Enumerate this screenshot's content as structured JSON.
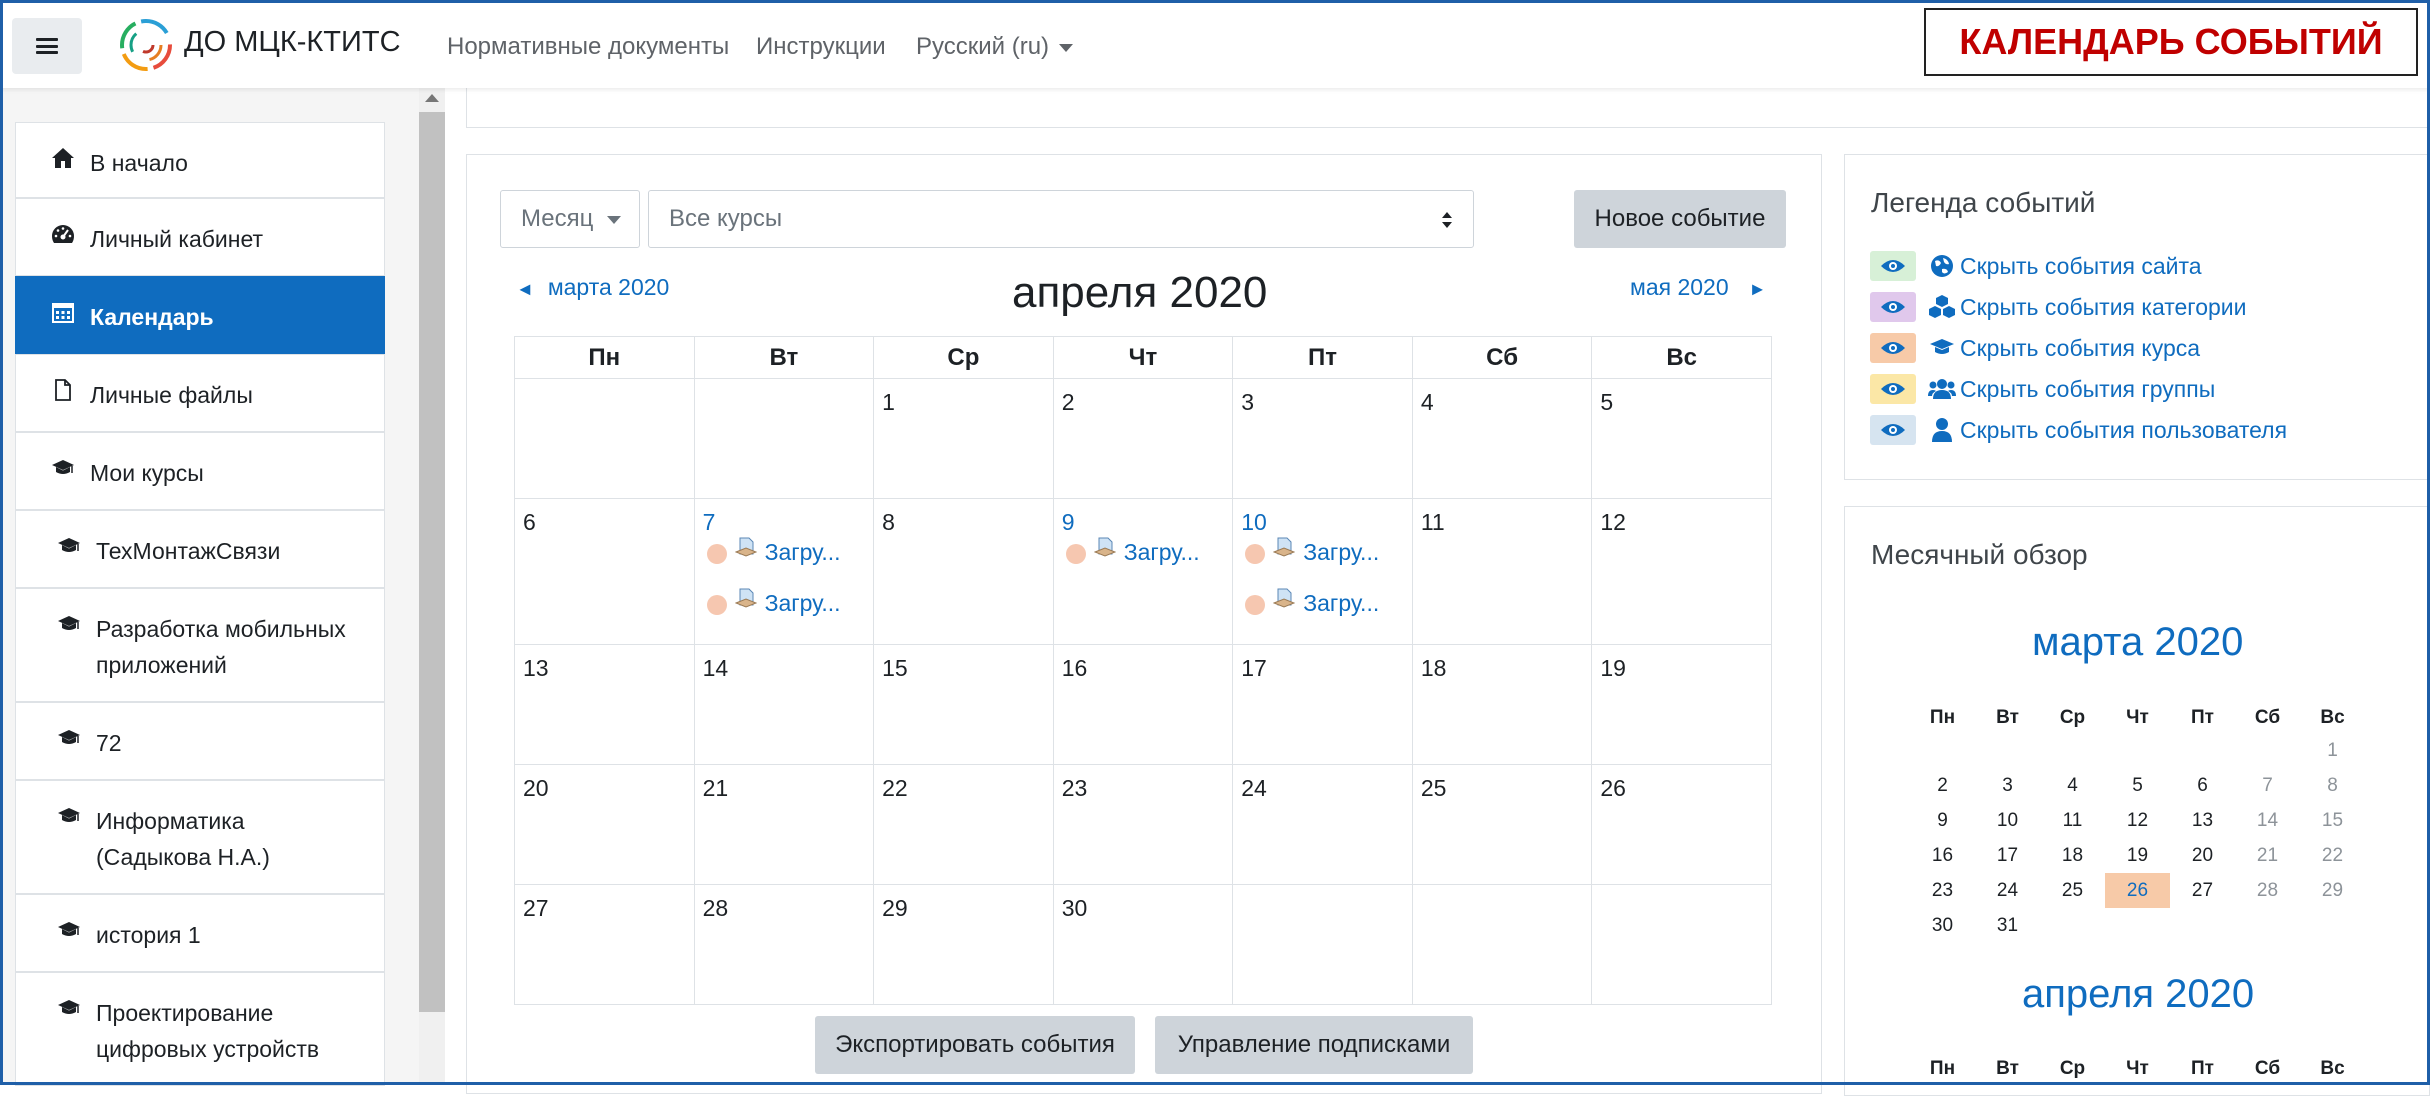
{
  "navbar": {
    "brand": "ДО МЦК-КТИТС",
    "links": [
      "Нормативные документы",
      "Инструкции",
      "Русский (ru)"
    ]
  },
  "annotation": "КАЛЕНДАРЬ СОБЫТИЙ",
  "drawer": {
    "items": [
      {
        "label": "В начало",
        "icon": "home-icon"
      },
      {
        "label": "Личный кабинет",
        "icon": "dashboard-icon"
      },
      {
        "label": "Календарь",
        "icon": "calendar-icon",
        "active": true
      },
      {
        "label": "Личные файлы",
        "icon": "file-icon"
      },
      {
        "label": "Мои курсы",
        "icon": "graduation-cap-icon"
      },
      {
        "label": "ТехМонтажСвязи",
        "icon": "graduation-cap-icon"
      },
      {
        "label": "Разработка мобильных",
        "label2": "приложений",
        "icon": "graduation-cap-icon"
      },
      {
        "label": "72",
        "icon": "graduation-cap-icon"
      },
      {
        "label": "Информатика",
        "label2": "(Садыкова Н.А.)",
        "icon": "graduation-cap-icon"
      },
      {
        "label": "история 1",
        "icon": "graduation-cap-icon"
      },
      {
        "label": "Проектирование",
        "label2": "цифровых устройств",
        "icon": "graduation-cap-icon"
      }
    ]
  },
  "calendar": {
    "view_select": "Месяц",
    "course_select": "Все курсы",
    "new_event": "Новое событие",
    "prev_month": "марта 2020",
    "next_month": "мая 2020",
    "title": "апреля 2020",
    "weekdays": [
      "Пн",
      "Вт",
      "Ср",
      "Чт",
      "Пт",
      "Сб",
      "Вс"
    ],
    "weeks": [
      [
        "",
        "",
        "1",
        "2",
        "3",
        "4",
        "5"
      ],
      [
        "6",
        "7",
        "8",
        "9",
        "10",
        "11",
        "12"
      ],
      [
        "13",
        "14",
        "15",
        "16",
        "17",
        "18",
        "19"
      ],
      [
        "20",
        "21",
        "22",
        "23",
        "24",
        "25",
        "26"
      ],
      [
        "27",
        "28",
        "29",
        "30",
        "",
        "",
        ""
      ]
    ],
    "events": {
      "7": [
        "Загру...",
        "Загру..."
      ],
      "9": [
        "Загру..."
      ],
      "10": [
        "Загру...",
        "Загру..."
      ]
    },
    "export_button": "Экспортировать события",
    "subscriptions_button": "Управление подписками"
  },
  "legend": {
    "title": "Легенда событий",
    "items": [
      {
        "label": "Скрыть события сайта",
        "color": "#d7f0d7",
        "icon": "globe-icon"
      },
      {
        "label": "Скрыть события категории",
        "color": "#e0c8ec",
        "icon": "cubes-icon"
      },
      {
        "label": "Скрыть события курса",
        "color": "#f7caa8",
        "icon": "graduation-cap-icon"
      },
      {
        "label": "Скрыть события группы",
        "color": "#fbe7a6",
        "icon": "users-icon"
      },
      {
        "label": "Скрыть события пользователя",
        "color": "#d6e4f0",
        "icon": "user-icon"
      }
    ]
  },
  "overview": {
    "title": "Месячный обзор",
    "march": {
      "title": "марта 2020",
      "weekdays": [
        "Пн",
        "Вт",
        "Ср",
        "Чт",
        "Пт",
        "Сб",
        "Вс"
      ],
      "weeks": [
        [
          "",
          "",
          "",
          "",
          "",
          "",
          "1"
        ],
        [
          "2",
          "3",
          "4",
          "5",
          "6",
          "7",
          "8"
        ],
        [
          "9",
          "10",
          "11",
          "12",
          "13",
          "14",
          "15"
        ],
        [
          "16",
          "17",
          "18",
          "19",
          "20",
          "21",
          "22"
        ],
        [
          "23",
          "24",
          "25",
          "26",
          "27",
          "28",
          "29"
        ],
        [
          "30",
          "31",
          "",
          "",
          "",
          "",
          ""
        ]
      ],
      "today": "26"
    },
    "april": {
      "title": "апреля 2020",
      "weekdays": [
        "Пн",
        "Вт",
        "Ср",
        "Чт",
        "Пт",
        "Сб",
        "Вс"
      ]
    }
  }
}
